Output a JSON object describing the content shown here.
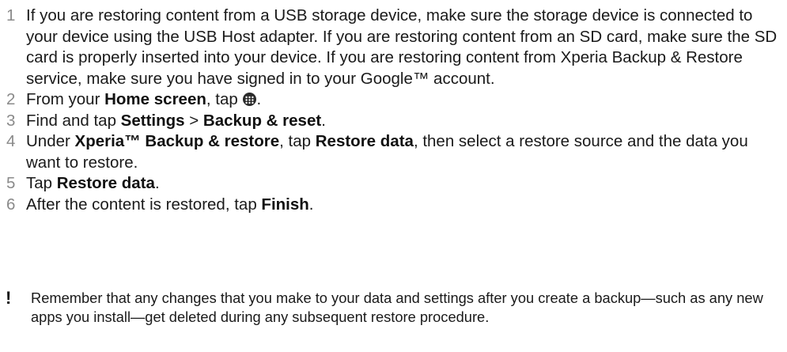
{
  "steps": [
    {
      "number": "1",
      "text": "If you are restoring content from a USB storage device, make sure the storage device is connected to your device using the USB Host adapter. If you are restoring content from an SD card, make sure the SD card is properly inserted into your device. If you are restoring content from Xperia Backup & Restore service, make sure you have signed in to your Google™ account."
    },
    {
      "number": "2",
      "prefix": "From your ",
      "bold": "Home screen",
      "suffix": ", tap ",
      "icon": "apps-icon",
      "end": "."
    },
    {
      "number": "3",
      "prefix": "Find and tap ",
      "bold1": "Settings",
      "middle": " > ",
      "bold2": "Backup & reset",
      "end": "."
    },
    {
      "number": "4",
      "prefix": "Under ",
      "bold1": "Xperia™ Backup & restore",
      "middle": ", tap ",
      "bold2": "Restore data",
      "suffix": ", then select a restore source and the data you want to restore."
    },
    {
      "number": "5",
      "prefix": "Tap ",
      "bold": "Restore data",
      "end": "."
    },
    {
      "number": "6",
      "prefix": "After the content is restored, tap ",
      "bold": "Finish",
      "end": "."
    }
  ],
  "note": {
    "icon": "!",
    "text": "Remember that any changes that you make to your data and settings after you create a backup—such as any new apps you install—get deleted during any subsequent restore procedure."
  }
}
